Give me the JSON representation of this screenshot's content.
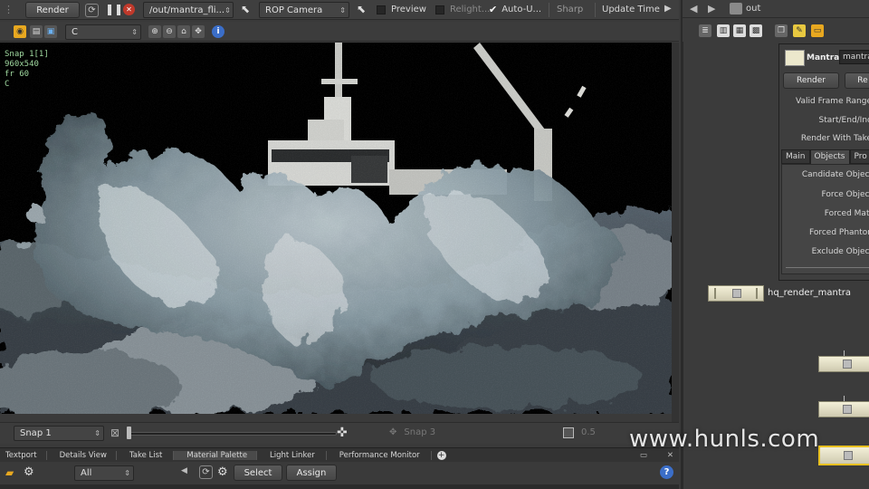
{
  "toolbar": {
    "render_label": "Render",
    "output_path": "/out/mantra_fli...",
    "camera": "ROP Camera",
    "preview_label": "Preview",
    "relight_label": "Relight...",
    "auto_update_label": "Auto-U...",
    "sharp_label": "Sharp",
    "update_time_label": "Update Time"
  },
  "viewer": {
    "channel": "C",
    "snap_label": "Snap 1[1]",
    "resolution": "960x540",
    "frame": "fr 60",
    "channel_overlay": "C"
  },
  "timeline": {
    "snap_select": "Snap 1",
    "snap_b": "Snap 3",
    "value": "0.5"
  },
  "bottom_tabs": [
    "Textport",
    "Details View",
    "Take List",
    "Material Palette",
    "Light Linker",
    "Performance Monitor"
  ],
  "material": {
    "filter": "All",
    "select_label": "Select",
    "assign_label": "Assign"
  },
  "network": {
    "path": "out",
    "node_type": "Mantra",
    "node_name": "mantra",
    "render_label": "Render",
    "render2_label": "Re",
    "params": [
      "Valid Frame Range",
      "Start/End/Inc",
      "Render With Take"
    ],
    "tabs": [
      "Main",
      "Objects",
      "Pro"
    ],
    "object_params": [
      "Candidate Object",
      "Force Object",
      "Forced Matt",
      "Forced Phanton",
      "Exclude Object"
    ],
    "node_label": "hq_render_mantra"
  },
  "watermark": "www.hunls.com",
  "colors": {
    "panel": "#3a3a3a",
    "toolbar": "#404040",
    "accent_orange": "#e8a820",
    "stop_red": "#c0392b",
    "help_blue": "#3b6ec8",
    "node_cream": "#ece8cc"
  }
}
